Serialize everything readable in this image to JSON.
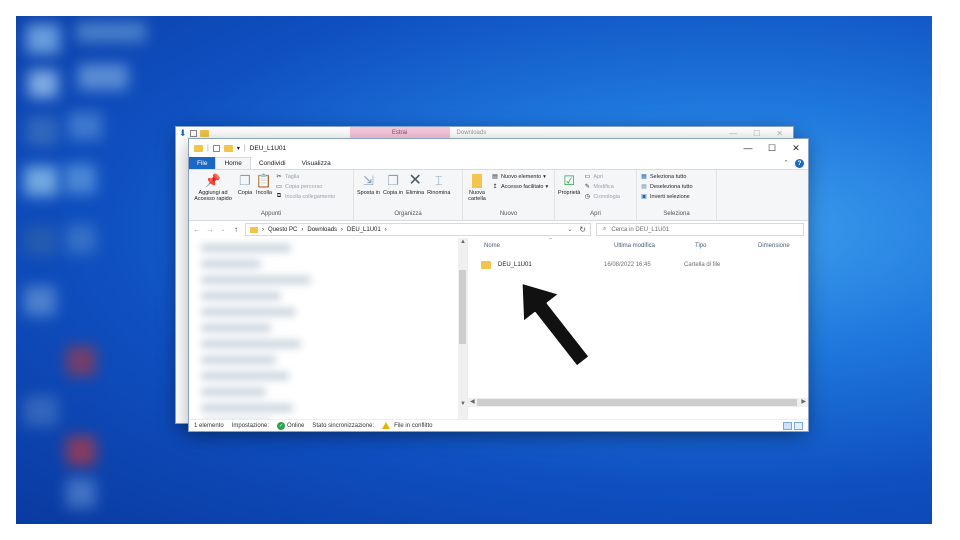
{
  "back_window": {
    "tab_label": "Estrai",
    "title": "Downloads",
    "controls": [
      "—",
      "☐",
      "✕"
    ]
  },
  "front_window": {
    "title": "DEU_L1U01",
    "controls": [
      "—",
      "☐",
      "✕"
    ]
  },
  "ribbon_tabs": [
    "File",
    "Home",
    "Condividi",
    "Visualizza"
  ],
  "ribbon": {
    "appunti": {
      "label": "Appunti",
      "pin": "Aggiungi ad Accesso rapido",
      "copy": "Copia",
      "paste": "Incolla",
      "cut": "Taglia",
      "copy_path": "Copia percorso",
      "paste_link": "Incolla collegamento"
    },
    "organizza": {
      "label": "Organizza",
      "move": "Sposta in",
      "copy_to": "Copia in",
      "delete": "Elimina",
      "rename": "Rinomina"
    },
    "nuovo": {
      "label": "Nuovo",
      "new_folder": "Nuova cartella",
      "new_item": "Nuovo elemento",
      "easy_access": "Accesso facilitato"
    },
    "apri": {
      "label": "Apri",
      "properties": "Proprietà",
      "open": "Apri",
      "edit": "Modifica",
      "history": "Cronologia"
    },
    "seleziona": {
      "label": "Seleziona",
      "select_all": "Seleziona tutto",
      "deselect_all": "Deseleziona tutto",
      "invert": "Inverti selezione"
    }
  },
  "address": {
    "crumbs": [
      "Questo PC",
      "Downloads",
      "DEU_L1U01"
    ],
    "search_placeholder": "Cerca in DEU_L1U01"
  },
  "columns": {
    "name": "Nome",
    "modified": "Ultima modifica",
    "type": "Tipo",
    "size": "Dimensione"
  },
  "files": [
    {
      "name": "DEU_L1U01",
      "modified": "16/08/2022 16:45",
      "type": "Cartella di file"
    }
  ],
  "status": {
    "count": "1 elemento",
    "setting": "Impostazione:",
    "online": "Online",
    "sync_state": "Stato sincronizzazione:",
    "conflict": "File in conflitto"
  }
}
